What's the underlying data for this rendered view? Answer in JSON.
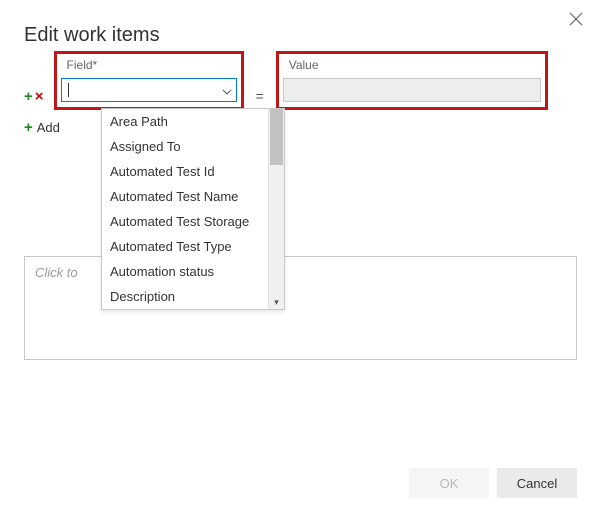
{
  "dialog": {
    "title": "Edit work items"
  },
  "row": {
    "field_label": "Field*",
    "value_label": "Value",
    "equals": "=",
    "field_value": "",
    "value_value": ""
  },
  "add": {
    "label": "Add",
    "plus": "+"
  },
  "icons": {
    "plus": "+",
    "x": "×"
  },
  "dropdown": {
    "items": [
      "Area Path",
      "Assigned To",
      "Automated Test Id",
      "Automated Test Name",
      "Automated Test Storage",
      "Automated Test Type",
      "Automation status",
      "Description"
    ]
  },
  "notes": {
    "placeholder": "Click to"
  },
  "buttons": {
    "ok": "OK",
    "cancel": "Cancel"
  }
}
